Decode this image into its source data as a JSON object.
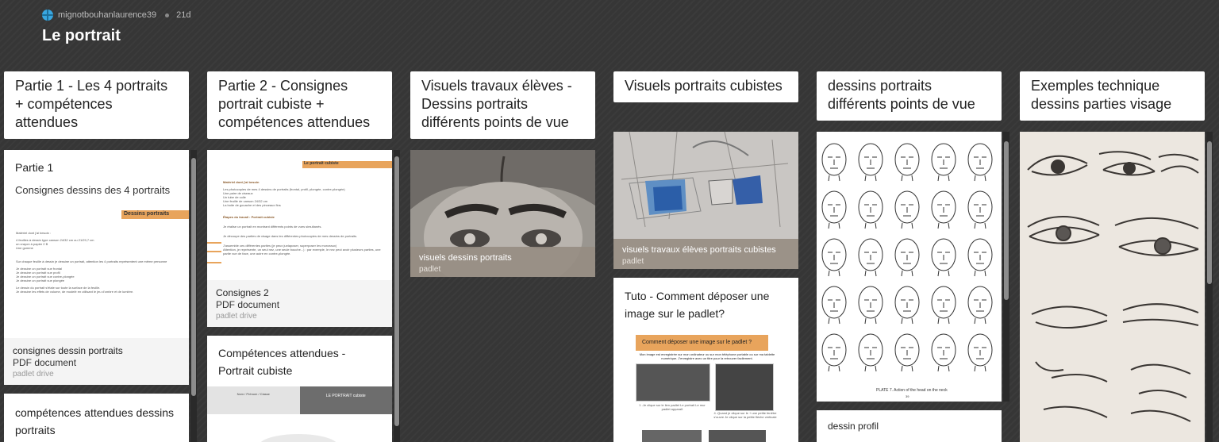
{
  "header": {
    "author": "mignotbouhanlaurence39",
    "age": "21d",
    "title": "Le portrait"
  },
  "columns": [
    {
      "title": "Partie 1 - Les 4 portraits + compétences attendues"
    },
    {
      "title": "Partie 2 - Consignes portrait cubiste + compétences attendues"
    },
    {
      "title": "Visuels travaux élèves - Dessins portraits différents points de vue"
    },
    {
      "title": "Visuels portraits cubistes"
    },
    {
      "title": "dessins portraits différents points de vue"
    },
    {
      "title": "Exemples technique dessins parties visage"
    }
  ],
  "col1": {
    "card1_heading": "Partie 1",
    "card1_text": "Consignes dessins des 4 portraits",
    "doc_header": "Dessins portraits",
    "doc_lines": [
      "Matériel dont j'ai besoin :",
      "4 feuilles à dessin type canson 24/32 cm ou 21/29,7 cm",
      "un crayon à papier 2 B",
      "Une gomme",
      "Sur chaque feuille à dessin je dessine un portrait, attention les 4 portraits représentent une même personne",
      "Je dessine un portrait vue frontal",
      "Je dessine un portrait vue profil",
      "Je dessine un portrait vue contre-plongée",
      "Je dessine un portrait vue plongée",
      "Le dessin du portrait s'étale sur toute la surface de la feuille.",
      "Je dessine les effets de volume, de modelé en utilisant le jeu d'ombre et de lumière."
    ],
    "attach_title": "consignes dessin portraits",
    "attach_type": "PDF document",
    "attach_src": "padlet drive",
    "card2_heading": "compétences attendues dessins portraits"
  },
  "col2": {
    "doc_header": "Le portrait cubiste",
    "doc_lines": [
      "Matériel dont j'ai besoin",
      "Les photocopies de mes 4 dessins de portraits (frontal, profil, plongée, contre-plongée)",
      "Une paire de ciseaux",
      "Un tube de colle",
      "Une feuille de canson 24/32 cm",
      "La boite de gouache et des pinceaux fins",
      "Étapes du travail : Portrait cubiste",
      "Je réalise un portrait en montrant différents points de vues simultanés.",
      "Je découpe des parties de visage dans les différentes photocopies de mes dessins de portraits.",
      "J'assemble ces différentes parties (je peux juxtaposer, superposer les morceaux)",
      "Attention, je représente, un seul nez, une seule bouche...) : par exemple, le nez peut avoir plusieurs parties, une partie vue de face, une autre en contre-plongée."
    ],
    "attach_title": "Consignes 2",
    "attach_type": "PDF document",
    "attach_src": "padlet drive",
    "card2_heading": "Compétences attendues - Portrait cubiste",
    "table_left": "Nom / Prénom / Classe",
    "table_right": "LE PORTRAIT cubiste"
  },
  "col3": {
    "overlay_title": "visuels dessins portraits",
    "overlay_src": "padlet"
  },
  "col4": {
    "overlay_title": "visuels travaux élèves portraits cubistes",
    "overlay_src": "padlet",
    "card2_heading": "Tuto - Comment déposer une image sur le padlet?",
    "tuto_header": "Comment déposer une image sur le padlet ?",
    "tuto_sub": "Mon image est enregistrée sur mon ordinateur ou sur mon téléphone portable ou sur ma tablette numérique. J'enregistre avec un titre pour la retrouver facilement.",
    "tuto_step1": "1 -Je clique sur le lien padlet Le portrait Le mur padlet apparaît",
    "tuto_step4": "4 -Quand je clique sur le + une petite fenêtre s'ouvre Je clique sur la petite flèche verticale"
  },
  "col5": {
    "plate_caption": "PLATE 7. Action of the head on the neck",
    "plate_page": "39",
    "card2_text": "dessin profil"
  },
  "colors": {
    "background": "#363636",
    "accent_orange": "#e8a45c",
    "overlay": "#968c82"
  }
}
